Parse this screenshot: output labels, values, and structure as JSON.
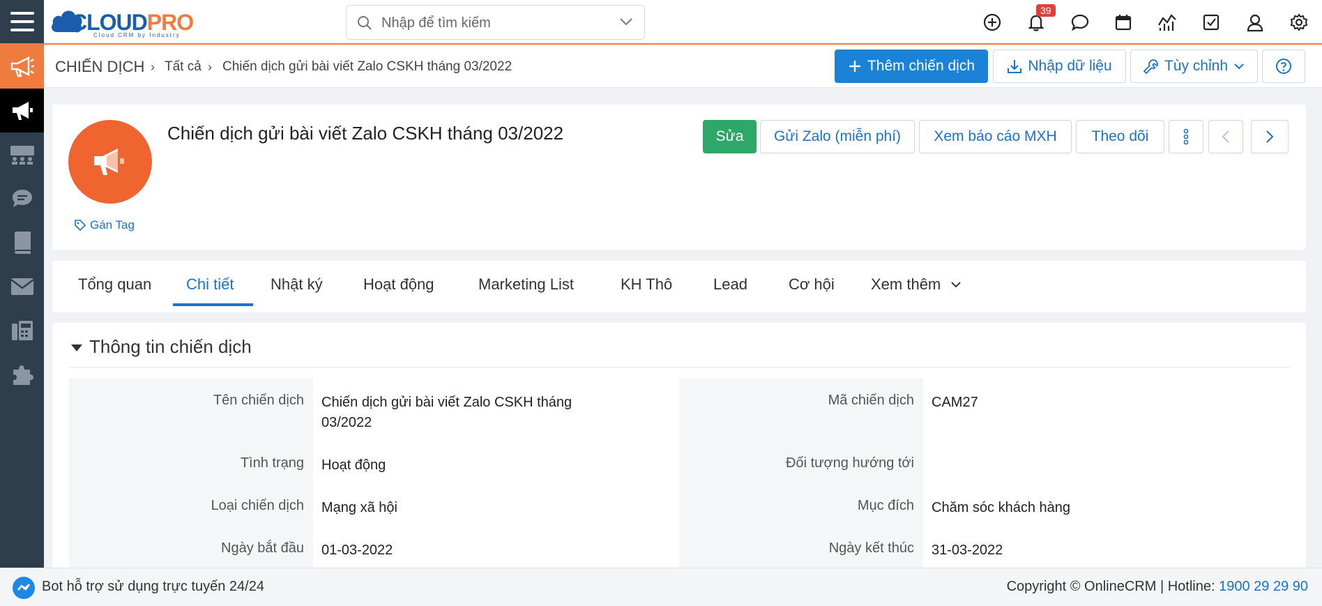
{
  "header": {
    "logo_text_a": "CLOUD",
    "logo_text_b": "PRO",
    "logo_sub": "Cloud CRM by Industry",
    "search_placeholder": "Nhập để tìm kiếm",
    "notification_count": "39",
    "icons": [
      "add-circle-icon",
      "bell-icon",
      "chat-icon",
      "calendar-icon",
      "chart-icon",
      "checkbox-icon",
      "user-icon",
      "gear-icon"
    ]
  },
  "sidebar": {
    "items": [
      "megaphone-icon",
      "megaphone-icon",
      "group-icon",
      "comment-icon",
      "book-icon",
      "mail-icon",
      "fax-icon",
      "puzzle-icon"
    ]
  },
  "breadcrumb": {
    "module": "CHIẾN DỊCH",
    "all": "Tất cả",
    "current": "Chiến dịch gửi bài viết Zalo CSKH tháng 03/2022"
  },
  "toolbar": {
    "add_label": "Thêm chiến dịch",
    "import_label": "Nhập dữ liệu",
    "customize_label": "Tùy chỉnh"
  },
  "record": {
    "title": "Chiến dịch gửi bài viết Zalo CSKH tháng 03/2022",
    "tag_label": "Gán Tag",
    "edit_label": "Sửa",
    "zalo_label": "Gửi Zalo (miễn phí)",
    "report_label": "Xem báo cáo MXH",
    "follow_label": "Theo dõi"
  },
  "tabs": [
    {
      "label": "Tổng quan"
    },
    {
      "label": "Chi tiết"
    },
    {
      "label": "Nhật ký"
    },
    {
      "label": "Hoạt động"
    },
    {
      "label": "Marketing List"
    },
    {
      "label": "KH Thô"
    },
    {
      "label": "Lead"
    },
    {
      "label": "Cơ hội"
    },
    {
      "label": "Xem thêm"
    }
  ],
  "section": {
    "title": "Thông tin chiến dịch",
    "left_fields": [
      {
        "label": "Tên chiến dịch",
        "value_line1": "Chiến dịch gửi bài viết Zalo CSKH tháng",
        "value_line2": "03/2022"
      },
      {
        "label": "Tình trạng",
        "value": "Hoạt động"
      },
      {
        "label": "Loại chiến dịch",
        "value": "Mạng xã hội"
      },
      {
        "label": "Ngày bắt đầu",
        "value": "01-03-2022"
      }
    ],
    "right_fields": [
      {
        "label": "Mã chiến dịch",
        "value": "CAM27"
      },
      {
        "label": "Đối tượng hướng tới",
        "value": ""
      },
      {
        "label": "Mục đích",
        "value": "Chăm sóc khách hàng"
      },
      {
        "label": "Ngày kết thúc",
        "value": "31-03-2022"
      }
    ]
  },
  "footer": {
    "bot_text": "Bot hỗ trợ sử dụng trực tuyến 24/24",
    "copyright": "Copyright © OnlineCRM",
    "hotline_label": "Hotline:",
    "hotline_number": "1900 29 29 90"
  },
  "colors": {
    "accent_blue": "#1a83d8",
    "brand_orange": "#f07b3f",
    "success_green": "#2ea86a",
    "sidebar_dark": "#2f3e4c"
  }
}
